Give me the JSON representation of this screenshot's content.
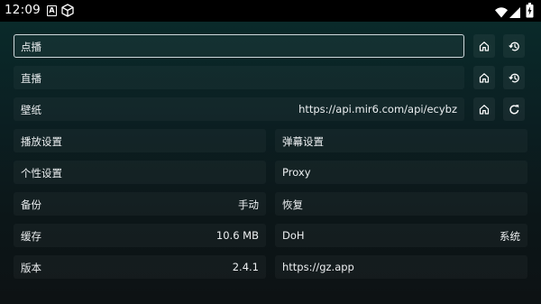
{
  "status_bar": {
    "time": "12:09",
    "a_icon": "A",
    "icons": [
      "a-notification-icon",
      "cube-icon",
      "wifi-icon",
      "signal-icon",
      "battery-icon"
    ]
  },
  "settings": {
    "vod": {
      "label": "点播"
    },
    "live": {
      "label": "直播"
    },
    "wallpaper": {
      "label": "壁纸",
      "value": "https://api.mir6.com/api/ecybz"
    },
    "playback": {
      "label": "播放设置"
    },
    "danmaku": {
      "label": "弹幕设置"
    },
    "personal": {
      "label": "个性设置"
    },
    "proxy": {
      "label": "Proxy"
    },
    "backup": {
      "label": "备份",
      "value": "手动"
    },
    "restore": {
      "label": "恢复"
    },
    "cache": {
      "label": "缓存",
      "value": "10.6 MB"
    },
    "doh": {
      "label": "DoH",
      "value": "系统"
    },
    "version": {
      "label": "版本",
      "value": "2.4.1"
    },
    "homepage": {
      "label": "https://gz.app"
    }
  },
  "icons": {
    "home": "home-icon",
    "history": "history-icon",
    "refresh": "refresh-icon"
  },
  "colors": {
    "background_top": "#0a2a2a",
    "background_bottom": "#0d1214",
    "text": "#eceff1",
    "focus_border": "#cfd8dc"
  }
}
